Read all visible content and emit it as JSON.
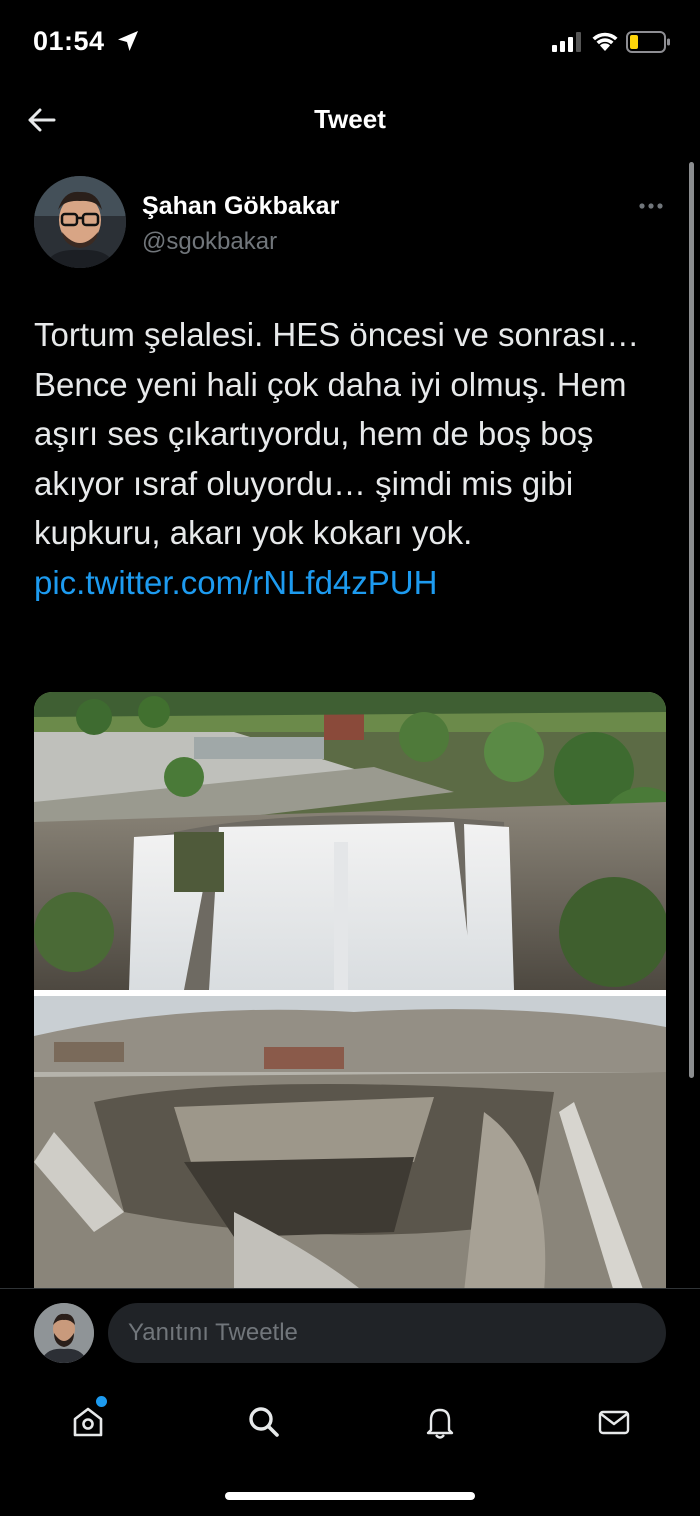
{
  "status_bar": {
    "time": "01:54"
  },
  "header": {
    "title": "Tweet"
  },
  "tweet": {
    "author_name": "Şahan Gökbakar",
    "author_handle": "@sgokbakar",
    "text": "Tortum şelalesi. HES öncesi ve sonrası… Bence yeni hali çok daha iyi olmuş. Hem aşırı ses çıkartıyordu, hem de boş boş akıyor ısraf oluyordu… şimdi mis gibi kupkuru, akarı yok kokarı yok. ",
    "link": "pic.twitter.com/rNLfd4zPUH"
  },
  "reply": {
    "placeholder": "Yanıtını Tweetle"
  },
  "colors": {
    "background": "#000000",
    "text": "#e7e9ea",
    "secondary": "#71767b",
    "accent": "#1d9bf0"
  },
  "icons": {
    "back": "arrow-left-icon",
    "more": "more-horizontal-icon",
    "home": "home-icon",
    "search": "search-icon",
    "notifications": "bell-icon",
    "messages": "mail-icon"
  }
}
